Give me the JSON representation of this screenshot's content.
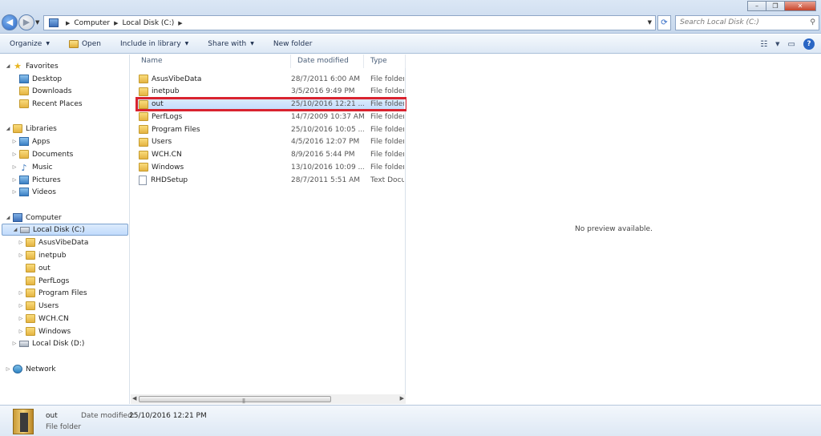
{
  "window": {
    "minimize_label": "–",
    "maximize_label": "❐",
    "close_label": "✕"
  },
  "address": {
    "crumbs": [
      "Computer",
      "Local Disk (C:)"
    ],
    "search_placeholder": "Search Local Disk (C:)"
  },
  "toolbar": {
    "organize": "Organize",
    "open": "Open",
    "include_in_library": "Include in library",
    "share_with": "Share with",
    "new_folder": "New folder"
  },
  "nav": {
    "favorites": "Favorites",
    "favorites_items": [
      "Desktop",
      "Downloads",
      "Recent Places"
    ],
    "libraries": "Libraries",
    "libraries_items": [
      "Apps",
      "Documents",
      "Music",
      "Pictures",
      "Videos"
    ],
    "computer": "Computer",
    "local_c": "Local Disk (C:)",
    "c_children": [
      "AsusVibeData",
      "inetpub",
      "out",
      "PerfLogs",
      "Program Files",
      "Users",
      "WCH.CN",
      "Windows"
    ],
    "local_d": "Local Disk (D:)",
    "network": "Network"
  },
  "columns": {
    "name": "Name",
    "date": "Date modified",
    "type": "Type"
  },
  "files": [
    {
      "name": "AsusVibeData",
      "date": "28/7/2011 6:00 AM",
      "type": "File folder",
      "kind": "folder"
    },
    {
      "name": "inetpub",
      "date": "3/5/2016 9:49 PM",
      "type": "File folder",
      "kind": "folder"
    },
    {
      "name": "out",
      "date": "25/10/2016 12:21 ...",
      "type": "File folder",
      "kind": "folder"
    },
    {
      "name": "PerfLogs",
      "date": "14/7/2009 10:37 AM",
      "type": "File folder",
      "kind": "folder"
    },
    {
      "name": "Program Files",
      "date": "25/10/2016 10:05 ...",
      "type": "File folder",
      "kind": "folder"
    },
    {
      "name": "Users",
      "date": "4/5/2016 12:07 PM",
      "type": "File folder",
      "kind": "folder"
    },
    {
      "name": "WCH.CN",
      "date": "8/9/2016 5:44 PM",
      "type": "File folder",
      "kind": "folder"
    },
    {
      "name": "Windows",
      "date": "13/10/2016 10:09 ...",
      "type": "File folder",
      "kind": "folder"
    },
    {
      "name": "RHDSetup",
      "date": "28/7/2011 5:51 AM",
      "type": "Text Docum",
      "kind": "text"
    }
  ],
  "preview": {
    "message": "No preview available."
  },
  "details": {
    "name": "out",
    "type": "File folder",
    "date_label": "Date modified:",
    "date_value": "25/10/2016 12:21 PM"
  },
  "colors": {
    "highlight_border": "#d9232f",
    "selection_bg": "#c1dbfc"
  }
}
